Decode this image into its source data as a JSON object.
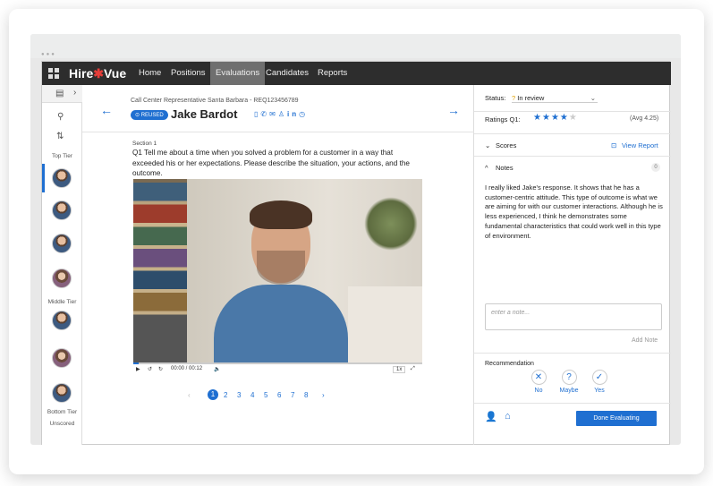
{
  "nav": {
    "brand": "HireVue",
    "brand_a": "Hire",
    "brand_b": "Vue",
    "tabs": [
      "Home",
      "Positions",
      "Evaluations",
      "Candidates",
      "Reports"
    ],
    "active_tab": "Evaluations"
  },
  "sidebar": {
    "tiers": {
      "top": "Top Tier",
      "middle": "Middle Tier",
      "bottom": "Bottom Tier",
      "unscored": "Unscored"
    }
  },
  "candidate": {
    "job": "Call Center Representative Santa Barbara - REQ123456789",
    "badge": "⊙ REUSED",
    "name": "Jake Bardot"
  },
  "question": {
    "section": "Section 1",
    "text": "Q1  Tell me about a time when you solved a problem for a customer in a way that exceeded his or her expectations. Please describe the situation, your actions, and the outcome."
  },
  "player": {
    "time": "00:00 / 00:12",
    "progress": 0.02,
    "speed": "1x"
  },
  "pager": {
    "pages": [
      "1",
      "2",
      "3",
      "4",
      "5",
      "6",
      "7",
      "8"
    ],
    "current": "1",
    "prev": "‹",
    "next": "›"
  },
  "right": {
    "status_label": "Status:",
    "status_value": "In review",
    "ratings_label": "Ratings  Q1:",
    "rating": 4,
    "rating_max": 5,
    "rating_avg": "(Avg 4.25)",
    "scores_label": "Scores",
    "view_report": "View Report",
    "notes_label": "Notes",
    "notes_count": "0",
    "note_text": "I really liked Jake's response. It shows that he has a customer-centric attitude. This type of outcome is what we are aiming for with our customer interactions. Although he is less experienced, I think he demonstrates some fundamental characteristics that could work well in this type of environment.",
    "note_placeholder": "enter a note...",
    "add_note": "Add Note",
    "recommendation_label": "Recommendation",
    "rec": [
      {
        "icon": "✕",
        "label": "No"
      },
      {
        "icon": "?",
        "label": "Maybe"
      },
      {
        "icon": "✓",
        "label": "Yes"
      }
    ],
    "done_label": "Done Evaluating"
  },
  "colors": {
    "accent": "#1f6fd1",
    "nav_bg": "#2d2d2d",
    "brand_red": "#e63d39"
  }
}
